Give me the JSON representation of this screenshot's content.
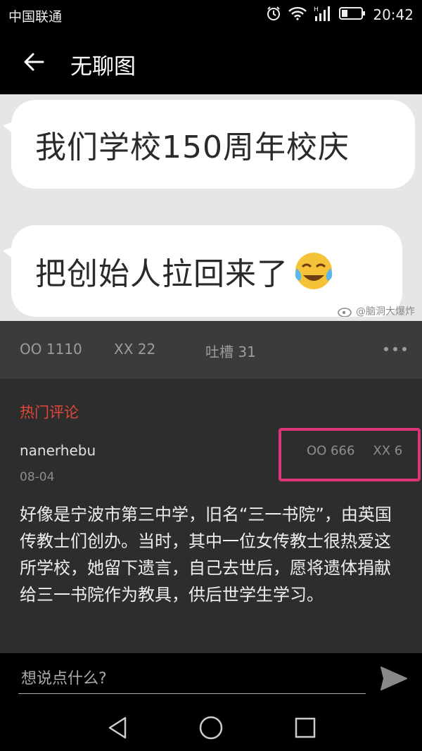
{
  "status_bar": {
    "carrier": "中国联通",
    "time": "20:42",
    "icons": [
      "alarm-icon",
      "wifi-icon",
      "signal-icon",
      "battery-icon"
    ]
  },
  "app_bar": {
    "title": "无聊图",
    "back_icon": "arrow-left-icon"
  },
  "post": {
    "image": {
      "bubble_1": "我们学校150周年校庆",
      "bubble_2": "把创始人拉回来了",
      "emoji": "laughing-crying-emoji",
      "watermark": "@脑洞大爆炸"
    },
    "stats": {
      "oo": "OO 1110",
      "xx": "XX 22",
      "tucao": "吐槽 31"
    }
  },
  "comments": {
    "section_title": "热门评论",
    "items": [
      {
        "user": "nanerhebu",
        "date": "08-04",
        "oo": "OO 666",
        "xx": "XX 6",
        "text": "好像是宁波市第三中学，旧名“三一书院”，由英国传教士们创办。当时，其中一位女传教士很热爱这所学校，她留下遗言，自己去世后，愿将遗体捐献给三一书院作为教具，供后世学生学习。"
      }
    ]
  },
  "input": {
    "placeholder": "想说点什么?",
    "value": ""
  },
  "nav": {
    "buttons": [
      "back-triangle-icon",
      "home-circle-icon",
      "recent-square-icon"
    ]
  },
  "colors": {
    "accent_red": "#e2463a",
    "highlight_pink": "#dd3377",
    "stats_bg": "#3b3b3b",
    "comments_bg": "#2d2d2d"
  }
}
